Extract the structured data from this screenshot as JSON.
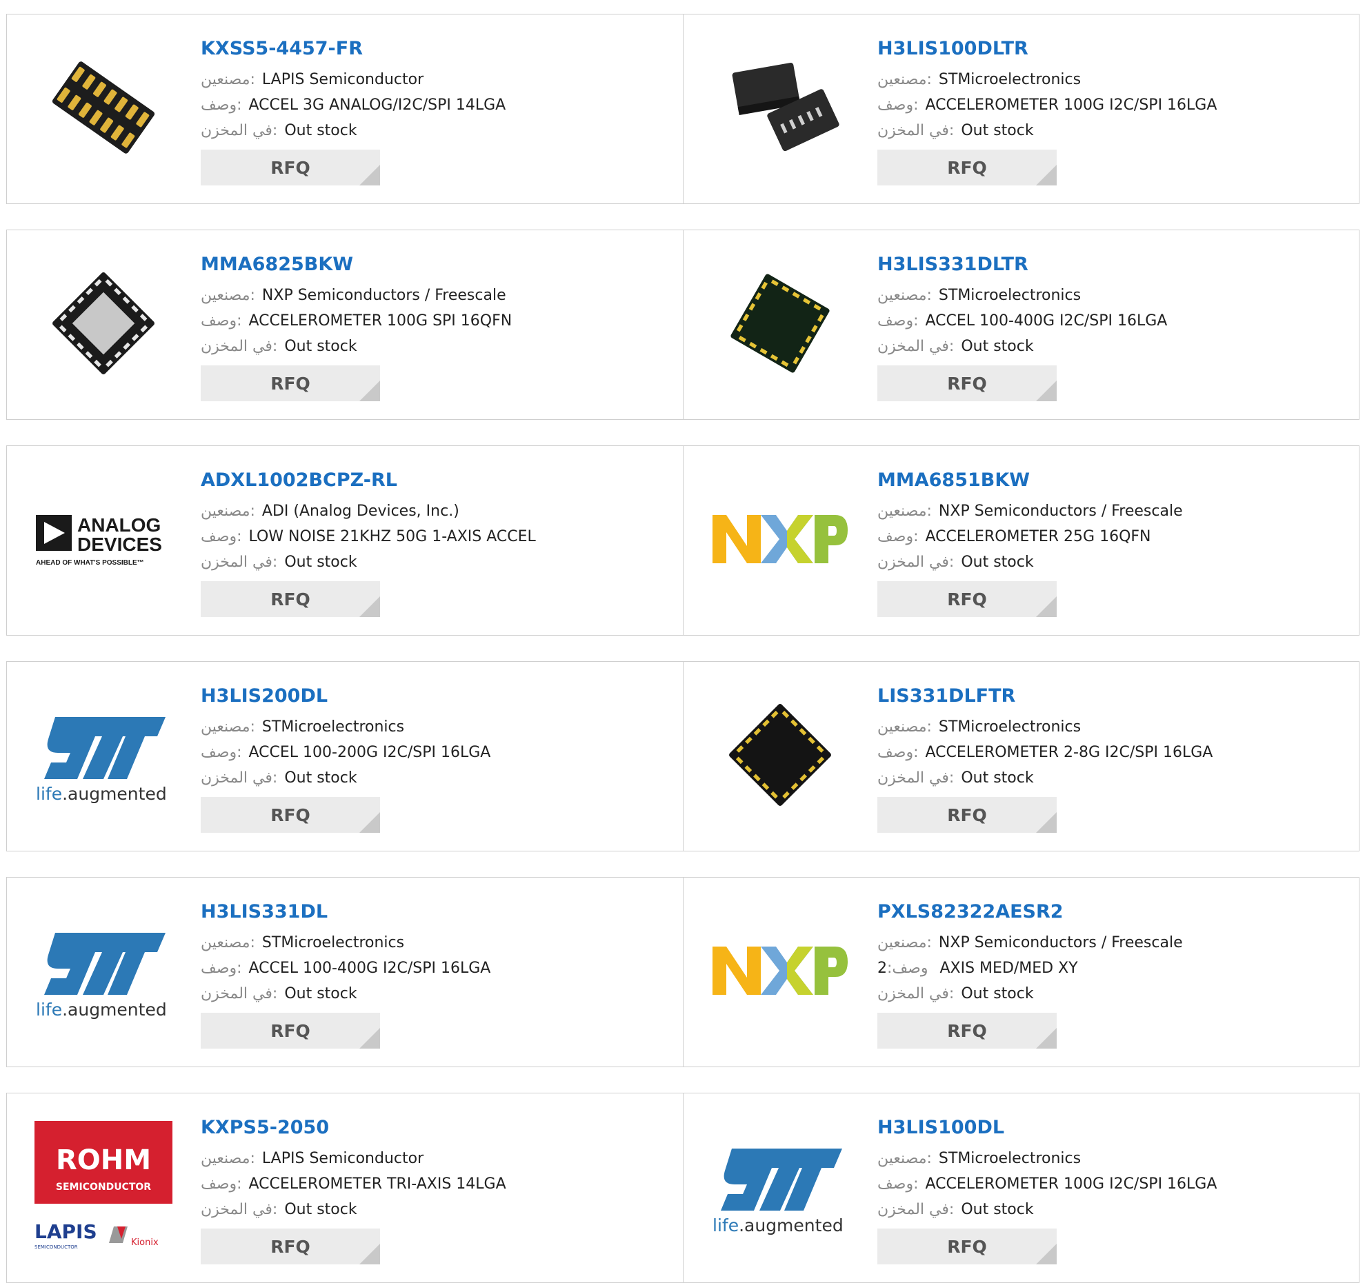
{
  "labels": {
    "manufacturer": "مصنعين:",
    "description": "وصف:",
    "stock": "في المخزن:"
  },
  "rfq_label": "RFQ",
  "products": [
    {
      "part": "KXSS5-4457-FR",
      "manufacturer": "LAPIS Semiconductor",
      "description": "ACCEL 3G ANALOG/I2C/SPI 14LGA",
      "stock": "Out stock",
      "image": "chip-lga14-gold-pads"
    },
    {
      "part": "H3LIS100DLTR",
      "manufacturer": "STMicroelectronics",
      "description": "ACCELEROMETER 100G I2C/SPI 16LGA",
      "stock": "Out stock",
      "image": "two-chips-lga16"
    },
    {
      "part": "MMA6825BKW",
      "manufacturer": "NXP Semiconductors / Freescale",
      "description": "ACCELEROMETER 100G SPI 16QFN",
      "stock": "Out stock",
      "image": "chip-qfn16-grey"
    },
    {
      "part": "H3LIS331DLTR",
      "manufacturer": "STMicroelectronics",
      "description": "ACCEL 100-400G I2C/SPI 16LGA",
      "stock": "Out stock",
      "image": "chip-lga16-green"
    },
    {
      "part": "ADXL1002BCPZ-RL",
      "manufacturer": "ADI (Analog Devices, Inc.)",
      "description": "LOW NOISE 21KHZ 50G 1-AXIS ACCEL",
      "stock": "Out stock",
      "image": "analog-devices-logo"
    },
    {
      "part": "MMA6851BKW",
      "manufacturer": "NXP Semiconductors / Freescale",
      "description": "ACCELEROMETER 25G 16QFN",
      "stock": "Out stock",
      "image": "nxp-logo"
    },
    {
      "part": "H3LIS200DL",
      "manufacturer": "STMicroelectronics",
      "description": "ACCEL 100-200G I2C/SPI 16LGA",
      "stock": "Out stock",
      "image": "st-logo"
    },
    {
      "part": "LIS331DLFTR",
      "manufacturer": "STMicroelectronics",
      "description": "ACCELEROMETER 2-8G I2C/SPI 16LGA",
      "stock": "Out stock",
      "image": "chip-lga16-black"
    },
    {
      "part": "H3LIS331DL",
      "manufacturer": "STMicroelectronics",
      "description": "ACCEL 100-400G I2C/SPI 16LGA",
      "stock": "Out stock",
      "image": "st-logo"
    },
    {
      "part": "PXLS82322AESR2",
      "manufacturer": "NXP Semiconductors / Freescale",
      "description": "2 AXIS MED/MED XY",
      "description_prefix": "2",
      "stock": "Out stock",
      "image": "nxp-logo"
    },
    {
      "part": "KXPS5-2050",
      "manufacturer": "LAPIS Semiconductor",
      "description": "ACCELEROMETER TRI-AXIS 14LGA",
      "stock": "Out stock",
      "image": "rohm-lapis-kionix-logo"
    },
    {
      "part": "H3LIS100DL",
      "manufacturer": "STMicroelectronics",
      "description": "ACCELEROMETER 100G I2C/SPI 16LGA",
      "stock": "Out stock",
      "image": "st-logo"
    }
  ],
  "logos": {
    "analog_devices": {
      "line1": "ANALOG",
      "line2": "DEVICES",
      "tagline": "AHEAD OF WHAT'S POSSIBLE™"
    },
    "st": {
      "tagline_a": "life",
      "tagline_b": ".augmented"
    },
    "rohm": {
      "name": "ROHM",
      "sub": "SEMICONDUCTOR",
      "lapis": "LAPIS",
      "lapis_sub": "SEMICONDUCTOR",
      "kionix": "Kionix"
    },
    "nxp": {
      "letters": [
        "N",
        "X",
        "P"
      ]
    }
  },
  "colors": {
    "link": "#1b6fc0",
    "rfq_bg": "#ebebeb",
    "border": "#cfcfcf",
    "nxp_n": "#f6b417",
    "nxp_x_a": "#6fa7d9",
    "nxp_x_b": "#c6d22e",
    "nxp_p": "#96c13d",
    "st_blue": "#2c79b6",
    "rohm_red": "#d5202f"
  }
}
